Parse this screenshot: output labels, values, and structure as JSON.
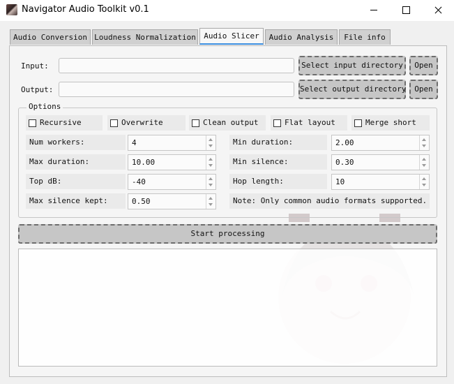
{
  "window": {
    "title": "Navigator Audio Toolkit v0.1"
  },
  "tabs": [
    {
      "label": "Audio Conversion"
    },
    {
      "label": "Loudness Normalization"
    },
    {
      "label": "Audio Slicer"
    },
    {
      "label": "Audio Analysis"
    },
    {
      "label": "File info"
    }
  ],
  "active_tab": "Audio Slicer",
  "io": {
    "input_label": "Input:",
    "input_value": "",
    "select_input_label": "Select input  directory",
    "open_input_label": "Open",
    "output_label": "Output:",
    "output_value": "",
    "select_output_label": "Select output directory",
    "open_output_label": "Open"
  },
  "options": {
    "title": "Options",
    "checkboxes": [
      {
        "label": "Recursive",
        "checked": false
      },
      {
        "label": "Overwrite",
        "checked": false
      },
      {
        "label": "Clean output",
        "checked": false
      },
      {
        "label": "Flat layout",
        "checked": false
      },
      {
        "label": "Merge short",
        "checked": false
      }
    ],
    "fields": {
      "num_workers": {
        "label": "Num workers:",
        "value": "4"
      },
      "min_duration": {
        "label": "Min duration:",
        "value": "2.00"
      },
      "max_duration": {
        "label": "Max duration:",
        "value": "10.00"
      },
      "min_silence": {
        "label": "Min silence:",
        "value": "0.30"
      },
      "top_db": {
        "label": "Top dB:",
        "value": "-40"
      },
      "hop_length": {
        "label": "Hop length:",
        "value": "10"
      },
      "max_silence_kept": {
        "label": "Max silence kept:",
        "value": "0.50"
      }
    },
    "note": "Note: Only common audio formats supported."
  },
  "start_button": {
    "label": "Start processing"
  },
  "log": {
    "text": ""
  },
  "icons": [
    "app-icon",
    "minimize-icon",
    "maximize-icon",
    "close-icon",
    "spin-up-icon",
    "spin-down-icon"
  ]
}
